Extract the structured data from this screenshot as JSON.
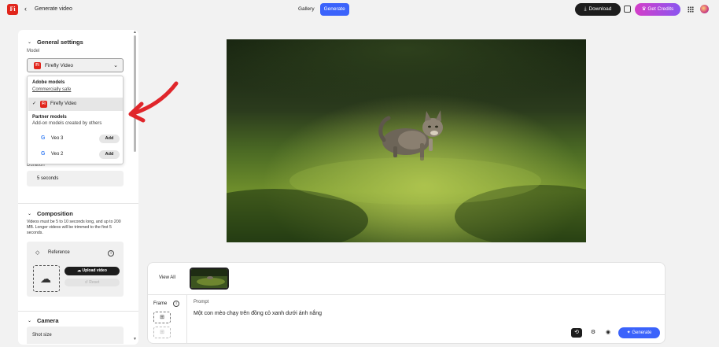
{
  "header": {
    "page_title": "Generate video",
    "tabs": [
      {
        "label": "Gallery",
        "active": false
      },
      {
        "label": "Generate",
        "active": true
      }
    ],
    "download_label": "Download",
    "credits_label": "Get Credits",
    "logo_text": "Fi"
  },
  "settings": {
    "general_title": "General settings",
    "model_label": "Model",
    "model_value": "Firefly Video",
    "dropdown": {
      "adobe_group": "Adobe models",
      "adobe_sub": "Commercially safe",
      "selected_option": "Firefly Video",
      "partner_group": "Partner models",
      "partner_sub": "Add-on models created by others",
      "partners": [
        {
          "label": "Veo 3",
          "action": "Add"
        },
        {
          "label": "Veo 2",
          "action": "Add"
        }
      ]
    },
    "duration_label": "Duration",
    "duration_value": "5 seconds",
    "composition_title": "Composition",
    "composition_note": "Videos must be 5 to 10 seconds long, and up to 200 MB. Longer videos will be trimmed to the first 5 seconds.",
    "reference_label": "Reference",
    "upload_label": "Upload video",
    "reset_label": "Reset",
    "camera_title": "Camera",
    "shot_size_label": "Shot size"
  },
  "bottom": {
    "view_all": "View All",
    "frame_label": "Frame",
    "prompt_label": "Prompt",
    "prompt_text": "Một con mèo chạy trên đồng cỏ xanh dưới ánh nắng",
    "generate_label": "Generate"
  },
  "colors": {
    "accent": "#3b63fb",
    "brand": "#e1251b",
    "annotation_arrow": "#e0262b"
  }
}
